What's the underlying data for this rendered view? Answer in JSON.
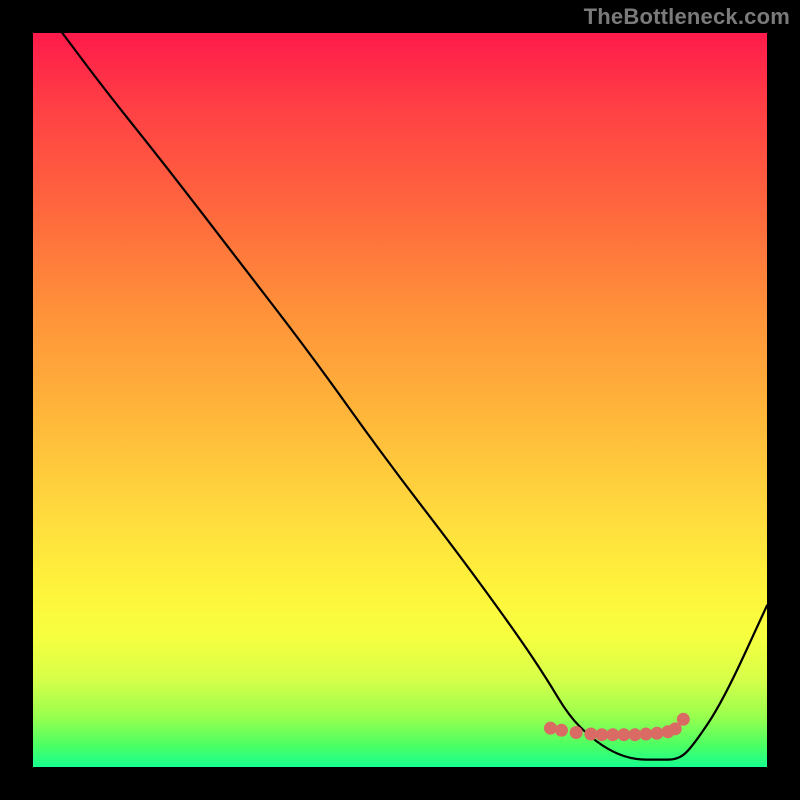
{
  "watermark": "TheBottleneck.com",
  "chart_data": {
    "type": "line",
    "title": "",
    "xlabel": "",
    "ylabel": "",
    "xlim": [
      0,
      100
    ],
    "ylim": [
      0,
      100
    ],
    "x": [
      4,
      10,
      18,
      28,
      38,
      48,
      58,
      66,
      70,
      73,
      76,
      79,
      82,
      85,
      88,
      90,
      94,
      100
    ],
    "values": [
      100,
      92,
      82,
      69,
      56,
      42,
      29,
      18,
      12,
      7,
      4,
      2,
      1,
      1,
      1,
      3,
      9,
      22
    ],
    "markers": {
      "x": [
        70.5,
        72,
        74,
        76,
        77.5,
        79,
        80.5,
        82,
        83.5,
        85,
        86.5,
        87.5,
        88.6
      ],
      "y": [
        5.3,
        5,
        4.7,
        4.5,
        4.4,
        4.4,
        4.4,
        4.4,
        4.5,
        4.6,
        4.8,
        5.2,
        6.5
      ],
      "color": "#d96b64",
      "size": 6.5
    }
  }
}
